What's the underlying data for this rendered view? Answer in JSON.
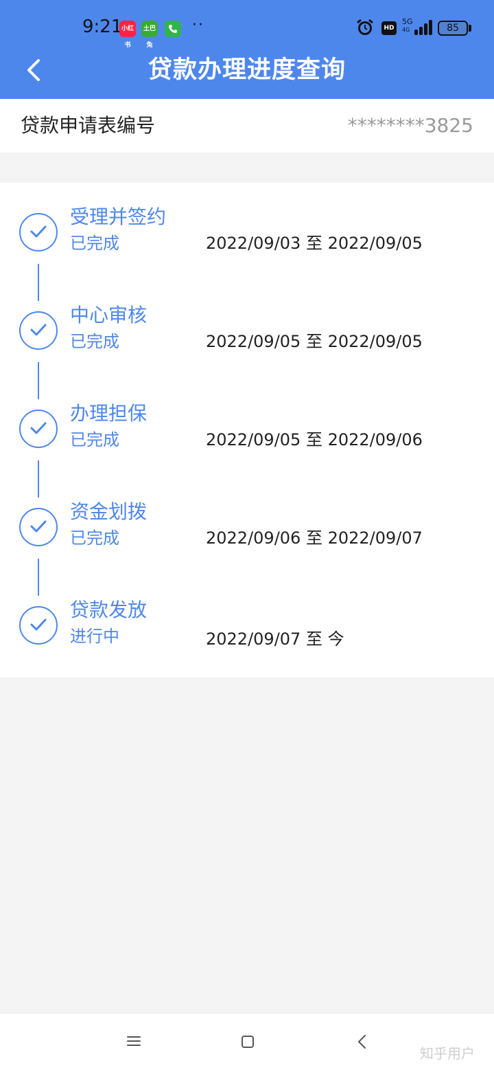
{
  "status_bar": {
    "time": "9:21",
    "app_icons": [
      {
        "name": "xiaohongshu-icon",
        "text": "小红书",
        "color": "#ff2442"
      },
      {
        "name": "store-icon",
        "text": "土巴兔",
        "color": "#3aaa35"
      },
      {
        "name": "phone-icon",
        "text": "",
        "color": "#31b44b"
      }
    ],
    "more": "··",
    "hd": "HD",
    "network": "5G",
    "network_sub": "4G",
    "battery": "85"
  },
  "header": {
    "title": "贷款办理进度查询",
    "back_icon": "chevron-left-icon",
    "color": "#4e87ec"
  },
  "application": {
    "label": "贷款申请表编号",
    "value": "********3825"
  },
  "steps": [
    {
      "title": "受理并签约",
      "status": "已完成",
      "date": "2022/09/03 至 2022/09/05"
    },
    {
      "title": "中心审核",
      "status": "已完成",
      "date": "2022/09/05 至 2022/09/05"
    },
    {
      "title": "办理担保",
      "status": "已完成",
      "date": "2022/09/05 至 2022/09/06"
    },
    {
      "title": "资金划拨",
      "status": "已完成",
      "date": "2022/09/06 至 2022/09/07"
    },
    {
      "title": "贷款发放",
      "status": "进行中",
      "date": "2022/09/07 至 今"
    }
  ],
  "nav": {
    "menu_icon": "menu-icon",
    "home_icon": "square-icon",
    "back_icon": "triangle-back-icon"
  },
  "watermark": "知乎用户"
}
